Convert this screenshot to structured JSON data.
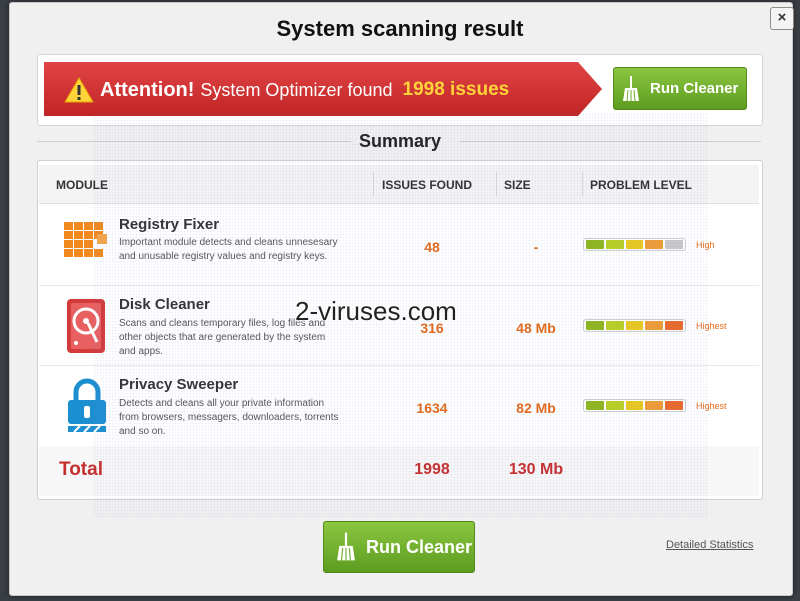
{
  "dialog": {
    "title": "System scanning result",
    "close_label": "×"
  },
  "alert": {
    "attention": "Attention!",
    "message": "System Optimizer found",
    "count": "1998 issues",
    "run_button": "Run Cleaner"
  },
  "summary_title": "Summary",
  "table": {
    "headers": {
      "module": "MODULE",
      "issues": "ISSUES FOUND",
      "size": "SIZE",
      "level": "PROBLEM LEVEL"
    },
    "rows": [
      {
        "name": "Registry Fixer",
        "description": "Important module detects and cleans unnesesary and unusable registry values and registry keys.",
        "issues": "48",
        "size": "-",
        "level": "High",
        "meter": [
          "#8fb61c",
          "#b9cf22",
          "#e9c91e",
          "#f09c35",
          "#c9c9c9"
        ]
      },
      {
        "name": "Disk Cleaner",
        "description": "Scans and cleans temporary files, log files and other objects that are generated by the system and apps.",
        "issues": "316",
        "size": "48 Mb",
        "level": "Highest",
        "meter": [
          "#8fb61c",
          "#b9cf22",
          "#e9c91e",
          "#f09c35",
          "#ea6a2a"
        ]
      },
      {
        "name": "Privacy Sweeper",
        "description": "Detects and cleans all your private information from browsers, messagers, downloaders, torrents and so on.",
        "issues": "1634",
        "size": "82 Mb",
        "level": "Highest",
        "meter": [
          "#8fb61c",
          "#b9cf22",
          "#e9c91e",
          "#f09c35",
          "#ea6a2a"
        ]
      }
    ],
    "total": {
      "label": "Total",
      "issues": "1998",
      "size": "130 Mb"
    }
  },
  "footer": {
    "run_button": "Run Cleaner",
    "details_link": "Detailed Statistics"
  },
  "watermark": "2-viruses.com",
  "colors": {
    "accent_red": "#c62f2f",
    "orange": "#e36a1a",
    "green": "#6aab2a"
  }
}
